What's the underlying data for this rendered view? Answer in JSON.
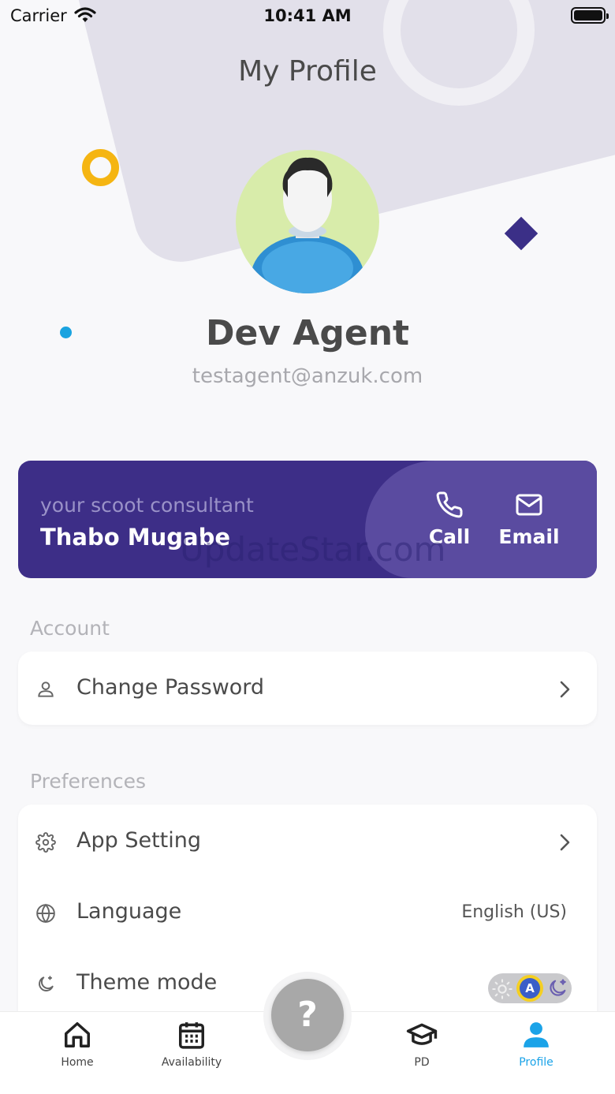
{
  "status_bar": {
    "carrier": "Carrier",
    "time": "10:41 AM"
  },
  "header": {
    "title": "My Profile"
  },
  "profile": {
    "name": "Dev Agent",
    "email": "testagent@anzuk.com"
  },
  "consultant": {
    "kicker": "your scoot consultant",
    "name": "Thabo Mugabe",
    "call_label": "Call",
    "email_label": "Email"
  },
  "watermark": "UpdateStar.com",
  "account": {
    "section_label": "Account",
    "items": [
      {
        "label": "Change Password",
        "icon": "user-icon"
      }
    ]
  },
  "preferences": {
    "section_label": "Preferences",
    "items": [
      {
        "label": "App Setting",
        "icon": "gear-icon"
      },
      {
        "label": "Language",
        "icon": "globe-icon",
        "value": "English (US)"
      },
      {
        "label": "Theme mode",
        "icon": "moon-icon",
        "toggle_selected": "A"
      }
    ]
  },
  "help": {
    "label": "?"
  },
  "tabs": [
    {
      "label": "Home",
      "icon": "home-icon"
    },
    {
      "label": "Availability",
      "icon": "calendar-icon"
    },
    {
      "label": "PD",
      "icon": "graduation-cap-icon"
    },
    {
      "label": "Profile",
      "icon": "person-icon",
      "active": true
    }
  ],
  "colors": {
    "brand": "#3d2e87",
    "accent": "#1ba3e8",
    "orange": "#f5b512"
  }
}
